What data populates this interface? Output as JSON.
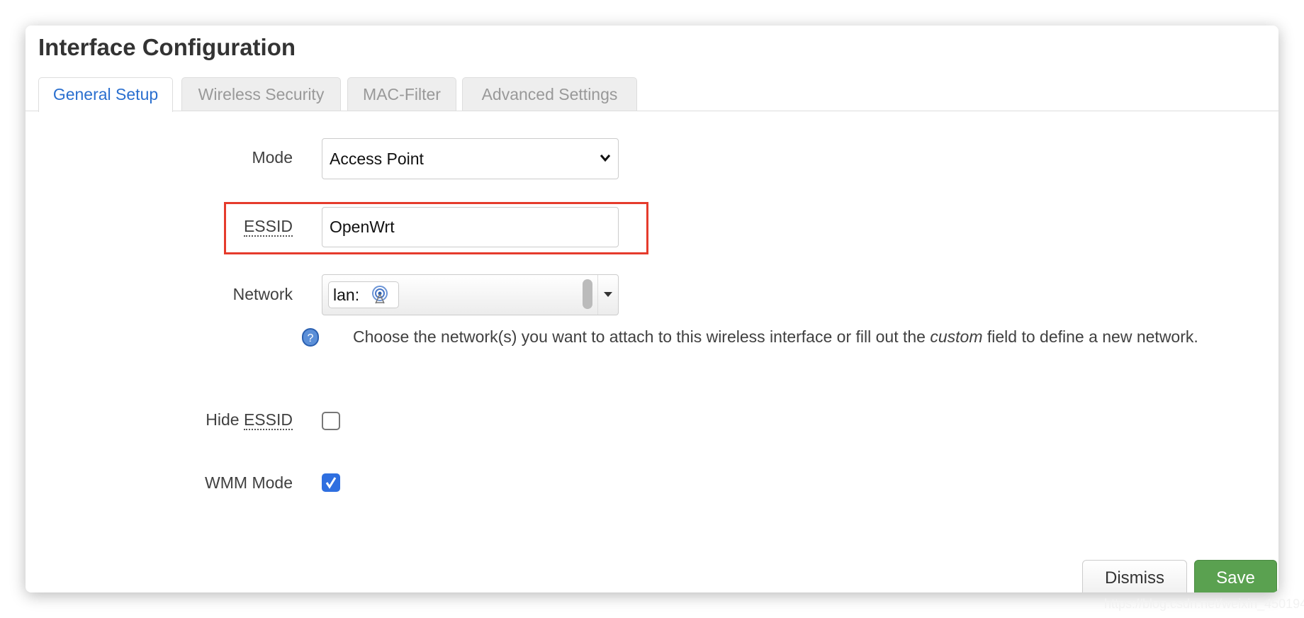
{
  "dialog": {
    "title": "Interface Configuration"
  },
  "tabs": [
    {
      "label": "General Setup",
      "active": true
    },
    {
      "label": "Wireless Security",
      "active": false
    },
    {
      "label": "MAC-Filter",
      "active": false
    },
    {
      "label": "Advanced Settings",
      "active": false
    }
  ],
  "form": {
    "mode": {
      "label": "Mode",
      "value": "Access Point"
    },
    "essid": {
      "label": "ESSID",
      "value": "OpenWrt"
    },
    "network": {
      "label": "Network",
      "value": "lan:",
      "help_before": "Choose the network(s) you want to attach to this wireless interface or fill out the ",
      "help_em": "custom",
      "help_after": " field to define a new network."
    },
    "hide_essid": {
      "label_prefix": "Hide ",
      "label_abbr": "ESSID",
      "checked": false
    },
    "wmm_mode": {
      "label": "WMM Mode",
      "checked": true
    }
  },
  "buttons": {
    "dismiss": "Dismiss",
    "save": "Save"
  },
  "watermark": "https://blog.csdn.net/weixin_4501947",
  "colors": {
    "accent": "#2a6fcf",
    "save": "#5aa150",
    "highlight": "#e53b2c"
  }
}
